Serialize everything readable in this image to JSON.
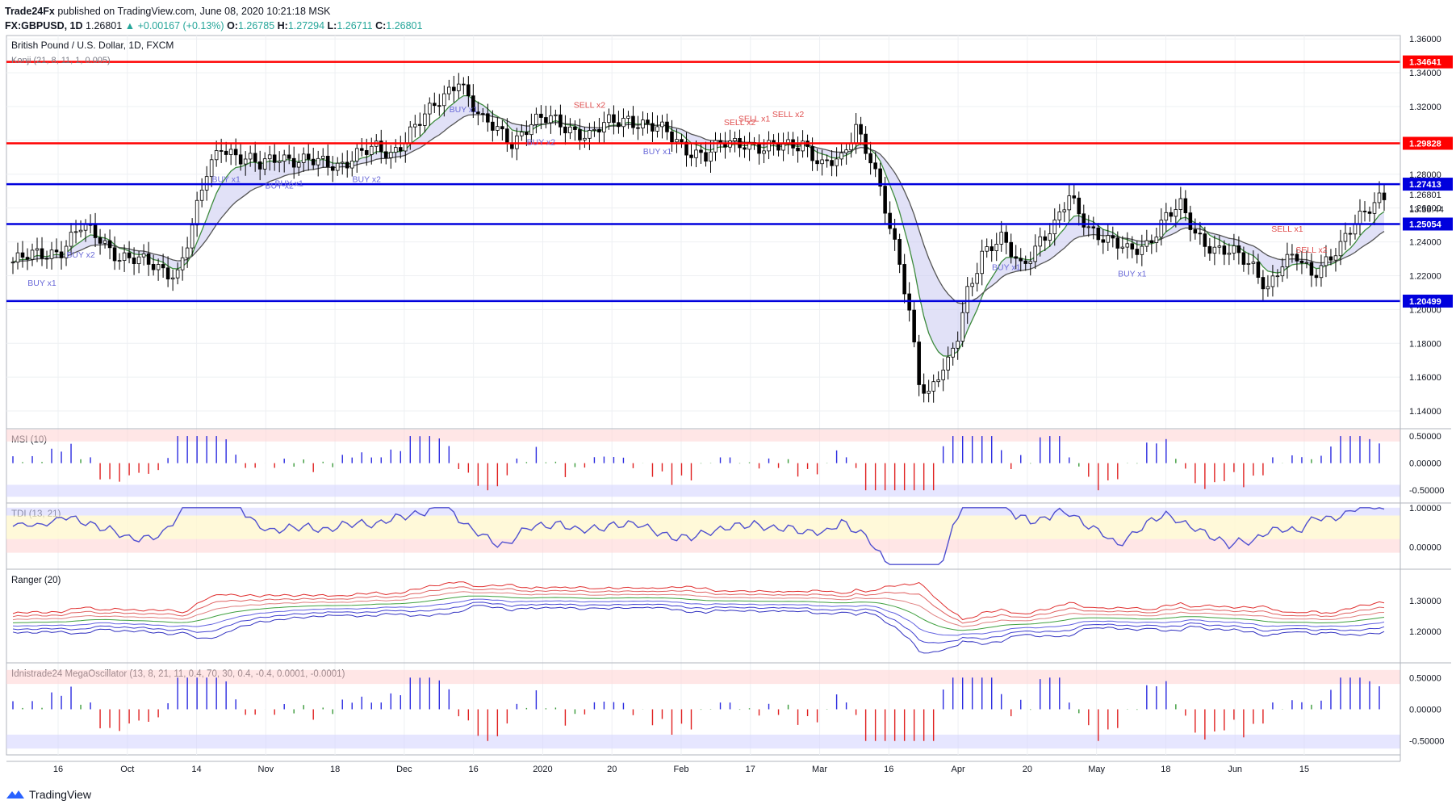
{
  "header": {
    "publisher": "Trade24Fx",
    "published_text": "published on TradingView.com, June 08, 2020 10:21:18 MSK",
    "symbol": "FX:GBPUSD, 1D",
    "last": "1.26801",
    "change": "+0.00167 (+0.13%)",
    "ohlc": {
      "o": "1.26785",
      "h": "1.27294",
      "l": "1.26711",
      "c": "1.26801"
    }
  },
  "footer": {
    "brand": "TradingView"
  },
  "colors": {
    "up": "#26a69a",
    "down": "#ef5350",
    "red_level": "#ff0000",
    "blue_level": "#0000dd",
    "buy": "#6a6ad8",
    "sell": "#e05050",
    "ma_green": "#3d8b3d",
    "ma_dark": "#555555"
  },
  "chart_data": {
    "type": "candlestick",
    "title": "British Pound / U.S. Dollar, 1D, FXCM",
    "indicator_label": "Konji (21, 8, 11, 1, 0.005)",
    "price_range": [
      1.13,
      1.362
    ],
    "y_ticks": [
      "1.36000",
      "1.34000",
      "1.32000",
      "1.30000",
      "1.28000",
      "1.26000",
      "1.24000",
      "1.22000",
      "1.20000",
      "1.18000",
      "1.16000",
      "1.14000"
    ],
    "x_ticks": [
      "16",
      "Oct",
      "14",
      "Nov",
      "18",
      "Dec",
      "16",
      "2020",
      "20",
      "Feb",
      "17",
      "Mar",
      "16",
      "Apr",
      "20",
      "May",
      "18",
      "Jun",
      "15"
    ],
    "levels": [
      {
        "label": "1.34641",
        "value": 1.34641,
        "color": "red"
      },
      {
        "label": "1.29828",
        "value": 1.29828,
        "color": "red"
      },
      {
        "label": "1.27413",
        "value": 1.27413,
        "color": "blue"
      },
      {
        "label": "1.25054",
        "value": 1.25054,
        "color": "blue"
      },
      {
        "label": "1.20499",
        "value": 1.20499,
        "color": "blue"
      }
    ],
    "last_price_label": "1.26801",
    "countdown_label": "13:38:44",
    "closes_anchor": [
      [
        0,
        1.228
      ],
      [
        10,
        1.236
      ],
      [
        14,
        1.248
      ],
      [
        18,
        1.242
      ],
      [
        22,
        1.232
      ],
      [
        26,
        1.228
      ],
      [
        31,
        1.224
      ],
      [
        34,
        1.222
      ],
      [
        37,
        1.248
      ],
      [
        40,
        1.28
      ],
      [
        43,
        1.298
      ],
      [
        47,
        1.29
      ],
      [
        51,
        1.284
      ],
      [
        55,
        1.292
      ],
      [
        59,
        1.288
      ],
      [
        63,
        1.286
      ],
      [
        67,
        1.286
      ],
      [
        71,
        1.292
      ],
      [
        75,
        1.294
      ],
      [
        78,
        1.292
      ],
      [
        82,
        1.306
      ],
      [
        86,
        1.316
      ],
      [
        89,
        1.326
      ],
      [
        92,
        1.338
      ],
      [
        95,
        1.32
      ],
      [
        97,
        1.31
      ],
      [
        100,
        1.306
      ],
      [
        103,
        1.3
      ],
      [
        107,
        1.31
      ],
      [
        111,
        1.312
      ],
      [
        115,
        1.308
      ],
      [
        119,
        1.302
      ],
      [
        123,
        1.31
      ],
      [
        127,
        1.314
      ],
      [
        131,
        1.308
      ],
      [
        135,
        1.304
      ],
      [
        139,
        1.296
      ],
      [
        143,
        1.29
      ],
      [
        147,
        1.298
      ],
      [
        151,
        1.3
      ],
      [
        155,
        1.294
      ],
      [
        159,
        1.296
      ],
      [
        163,
        1.3
      ],
      [
        167,
        1.284
      ],
      [
        171,
        1.288
      ],
      [
        174,
        1.31
      ],
      [
        177,
        1.29
      ],
      [
        179,
        1.27
      ],
      [
        181,
        1.246
      ],
      [
        183,
        1.226
      ],
      [
        185,
        1.2
      ],
      [
        187,
        1.16
      ],
      [
        189,
        1.15
      ],
      [
        191,
        1.16
      ],
      [
        193,
        1.166
      ],
      [
        195,
        1.184
      ],
      [
        197,
        1.212
      ],
      [
        200,
        1.234
      ],
      [
        204,
        1.24
      ],
      [
        208,
        1.226
      ],
      [
        212,
        1.242
      ],
      [
        215,
        1.248
      ],
      [
        218,
        1.266
      ],
      [
        222,
        1.25
      ],
      [
        226,
        1.24
      ],
      [
        230,
        1.234
      ],
      [
        234,
        1.24
      ],
      [
        238,
        1.254
      ],
      [
        241,
        1.26
      ],
      [
        244,
        1.246
      ],
      [
        248,
        1.236
      ],
      [
        252,
        1.232
      ],
      [
        256,
        1.226
      ],
      [
        259,
        1.214
      ],
      [
        262,
        1.226
      ],
      [
        265,
        1.23
      ],
      [
        268,
        1.222
      ],
      [
        271,
        1.23
      ],
      [
        274,
        1.236
      ],
      [
        277,
        1.25
      ],
      [
        280,
        1.262
      ],
      [
        282,
        1.268
      ]
    ],
    "overbought_stars": [
      {
        "label": "BUY x1",
        "i": 6
      },
      {
        "label": "BUY x2",
        "i": 14
      },
      {
        "label": "BUY x1",
        "i": 44
      },
      {
        "label": "BUY x2",
        "i": 55
      },
      {
        "label": "BUY x1",
        "i": 57
      },
      {
        "label": "BUY x2",
        "i": 73
      },
      {
        "label": "BUY x1",
        "i": 93
      },
      {
        "label": "BUY x2",
        "i": 109
      },
      {
        "label": "BUY x1",
        "i": 133
      },
      {
        "label": "SELL x2",
        "i": 119
      },
      {
        "label": "SELL x2",
        "i": 150
      },
      {
        "label": "SELL x1",
        "i": 153
      },
      {
        "label": "SELL x2",
        "i": 160
      },
      {
        "label": "BUY x1",
        "i": 205
      },
      {
        "label": "BUY x1",
        "i": 231
      },
      {
        "label": "SELL x1",
        "i": 263
      },
      {
        "label": "SELL x2",
        "i": 268
      }
    ],
    "sub_panels": [
      {
        "name": "MSI (10)",
        "ticks": [
          "0.50000",
          "0.00000",
          "-0.50000"
        ],
        "range": [
          -0.72,
          0.62
        ]
      },
      {
        "name": "TDI (13, 21)",
        "ticks": [
          "1.00000",
          "0.00000"
        ],
        "range": [
          -0.55,
          1.1
        ]
      },
      {
        "name": "Ranger (20)",
        "ticks": [
          "1.30000",
          "1.20000"
        ],
        "range": [
          1.1,
          1.4
        ]
      },
      {
        "name": "Idnistrade24 MegaOscillator (13, 8, 21, 11, 0.4, 70, 30, 0.4, -0.4, 0.0001, -0.0001)",
        "ticks": [
          "0.50000",
          "0.00000",
          "-0.50000"
        ],
        "range": [
          -0.72,
          0.72
        ]
      }
    ]
  }
}
